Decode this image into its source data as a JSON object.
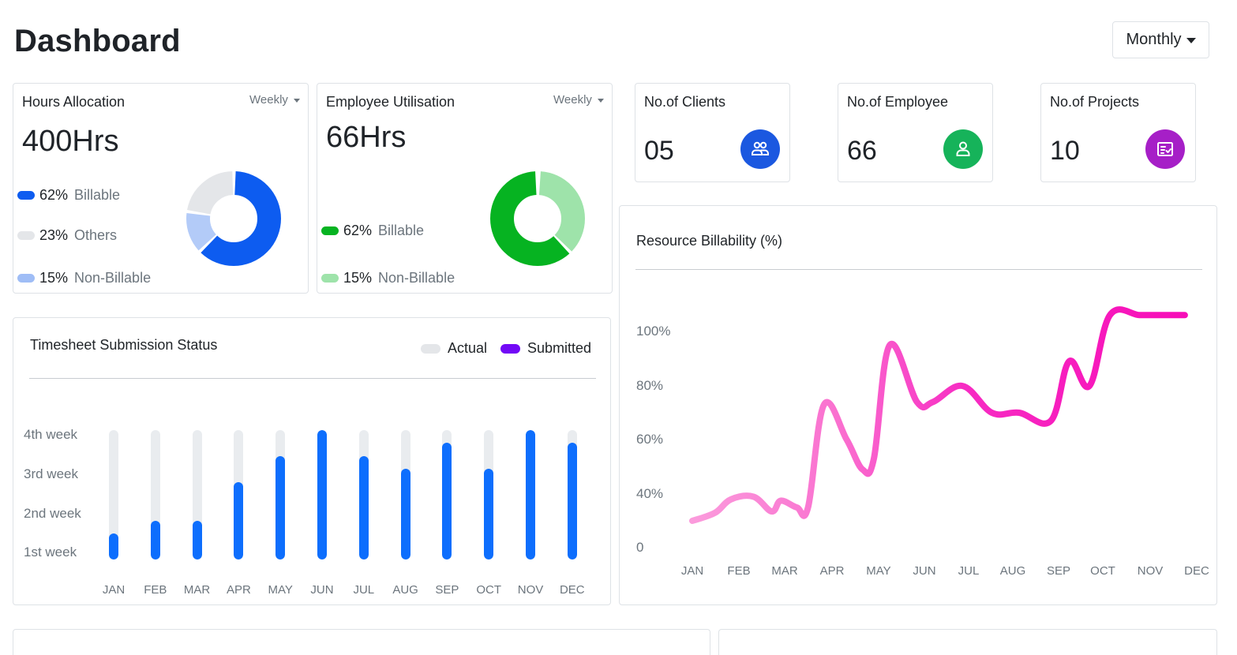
{
  "header": {
    "title": "Dashboard",
    "period": "Monthly"
  },
  "hours_allocation": {
    "title": "Hours Allocation",
    "filter": "Weekly",
    "value": "400Hrs",
    "legend": [
      {
        "pct": "62%",
        "label": "Billable",
        "color": "#0d5cf0"
      },
      {
        "pct": "23%",
        "label": "Others",
        "color": "#e4e6e9"
      },
      {
        "pct": "15%",
        "label": "Non-Billable",
        "color": "#9fbdf6"
      }
    ],
    "donut": [
      62,
      15,
      23
    ]
  },
  "employee_utilisation": {
    "title": "Employee Utilisation",
    "filter": "Weekly",
    "value": "66Hrs",
    "legend": [
      {
        "pct": "62%",
        "label": "Billable",
        "color": "#06b321"
      },
      {
        "pct": "15%",
        "label": "Non-Billable",
        "color": "#9ee3aa"
      }
    ],
    "donut": [
      62,
      38
    ]
  },
  "stats": [
    {
      "title": "No.of Clients",
      "value": "05",
      "icon": "clients-icon",
      "color": "#1b58e0"
    },
    {
      "title": "No.of Employee",
      "value": "66",
      "icon": "employee-icon",
      "color": "#16b35a"
    },
    {
      "title": "No.of Projects",
      "value": "10",
      "icon": "projects-icon",
      "color": "#a61fc7"
    }
  ],
  "timesheet": {
    "title": "Timesheet Submission Status",
    "legend_actual": "Actual",
    "legend_submitted": "Submitted",
    "legend_colors": {
      "actual": "#e4e6e9",
      "submitted": "#7209f6"
    },
    "bar_color": "#0d6efd",
    "y_labels": [
      "4th week",
      "3rd week",
      "2nd week",
      "1st week"
    ]
  },
  "resource_billability": {
    "title": "Resource Billability (%)",
    "y_labels": [
      "100%",
      "80%",
      "60%",
      "40%",
      "0"
    ],
    "line_color_start": "#fb95d8",
    "line_color_end": "#f70dbb"
  },
  "chart_data": [
    {
      "type": "bar",
      "title": "Timesheet Submission Status",
      "categories": [
        "JAN",
        "FEB",
        "MAR",
        "APR",
        "MAY",
        "JUN",
        "JUL",
        "AUG",
        "SEP",
        "OCT",
        "NOV",
        "DEC"
      ],
      "yticks": [
        "1st week",
        "2nd week",
        "3rd week",
        "4th week"
      ],
      "ylim": [
        0,
        5
      ],
      "series": [
        {
          "name": "Actual",
          "values": [
            5,
            5,
            5,
            5,
            5,
            5,
            5,
            5,
            5,
            5,
            5,
            5
          ]
        },
        {
          "name": "Submitted",
          "values": [
            1,
            1.5,
            1.5,
            3,
            4,
            5,
            4,
            3.5,
            4.5,
            3.5,
            5,
            4.5
          ]
        }
      ]
    },
    {
      "type": "line",
      "title": "Resource Billability (%)",
      "categories": [
        "JAN",
        "FEB",
        "MAR",
        "APR",
        "MAY",
        "JUN",
        "JUL",
        "AUG",
        "SEP",
        "OCT",
        "NOV",
        "DEC"
      ],
      "yticks": [
        "0",
        "40%",
        "60%",
        "80%",
        "100%"
      ],
      "x": [
        0,
        0.5,
        0.85,
        1.35,
        1.75,
        1.95,
        2.3,
        2.55,
        2.9,
        3.4,
        3.75,
        4.0,
        4.35,
        4.95,
        5.3,
        5.95,
        6.6,
        7.2,
        7.9,
        8.3,
        8.75,
        9.2,
        9.85,
        10.25,
        10.85
      ],
      "values": [
        20,
        26,
        36,
        38,
        27,
        35,
        30,
        30,
        73,
        60,
        49,
        53,
        95,
        74,
        74,
        80,
        70,
        70,
        67,
        89,
        80,
        106,
        106,
        106,
        106
      ],
      "ylim": [
        0,
        110
      ]
    }
  ]
}
